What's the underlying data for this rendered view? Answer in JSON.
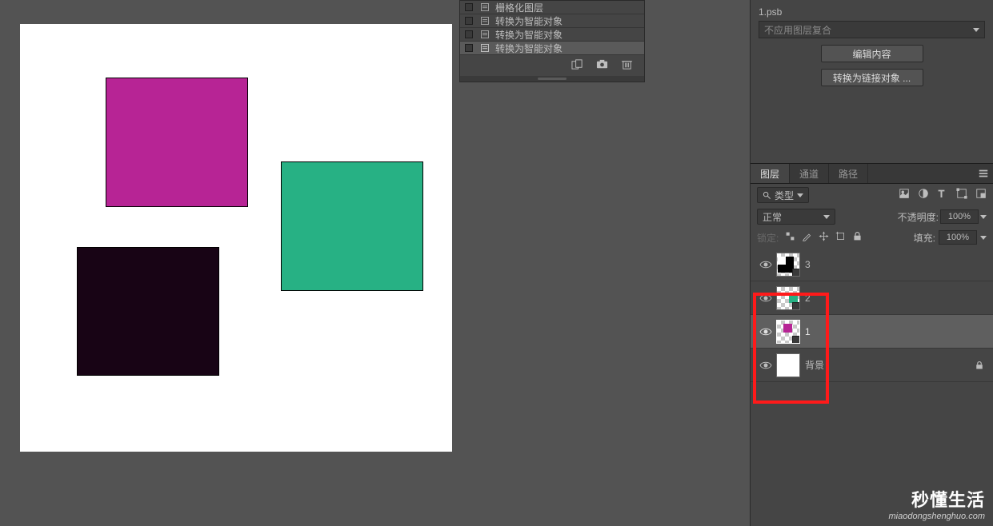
{
  "canvas": {
    "shapes": {
      "purple": "#b72495",
      "green": "#27b184",
      "black": "#180415"
    }
  },
  "history": {
    "items": [
      {
        "label": "栅格化图层",
        "active": false
      },
      {
        "label": "转换为智能对象",
        "active": false
      },
      {
        "label": "转换为智能对象",
        "active": false
      },
      {
        "label": "转换为智能对象",
        "active": true
      }
    ]
  },
  "properties": {
    "psb_label": "1.psb",
    "layer_comp_label": "不应用图层复合",
    "edit_btn": "编辑内容",
    "convert_btn": "转换为链接对象 ..."
  },
  "layers_panel": {
    "tabs": [
      "图层",
      "通道",
      "路径"
    ],
    "active_tab": 0,
    "filter_label": "类型",
    "blend_mode": "正常",
    "opacity_label": "不透明度:",
    "opacity_value": "100%",
    "fill_label": "填充:",
    "fill_value": "100%",
    "lock_label": "锁定:",
    "layers": [
      {
        "name": "3",
        "selected": false,
        "thumb_type": "blackwhite"
      },
      {
        "name": "2",
        "selected": false,
        "thumb_type": "green"
      },
      {
        "name": "1",
        "selected": true,
        "thumb_type": "purple"
      },
      {
        "name": "背景",
        "selected": false,
        "thumb_type": "white",
        "locked": true
      }
    ]
  },
  "watermark": {
    "line1": "秒懂生活",
    "line2": "miaodongshenghuo.com"
  }
}
